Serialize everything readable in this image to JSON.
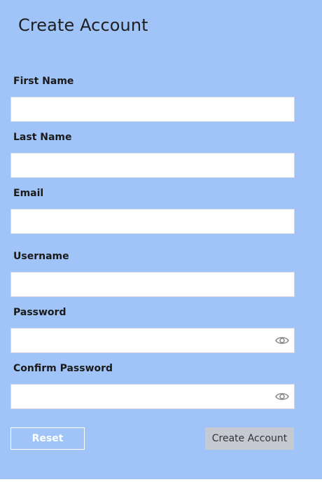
{
  "page": {
    "title": "Create Account",
    "background_color": "#a0c4f8"
  },
  "form": {
    "first_name": {
      "label": "First Name",
      "value": "",
      "placeholder": ""
    },
    "last_name": {
      "label": "Last Name",
      "value": "",
      "placeholder": ""
    },
    "email": {
      "label": "Email",
      "value": "",
      "placeholder": ""
    },
    "username": {
      "label": "Username",
      "value": "",
      "placeholder": ""
    },
    "password": {
      "label": "Password",
      "value": "",
      "placeholder": "",
      "reveal_icon": "eye-icon"
    },
    "confirm_password": {
      "label": "Confirm Password",
      "value": "",
      "placeholder": "",
      "reveal_icon": "eye-icon"
    }
  },
  "actions": {
    "reset_label": "Reset",
    "create_label": "Create Account",
    "create_button_color": "#c4c9d2"
  }
}
